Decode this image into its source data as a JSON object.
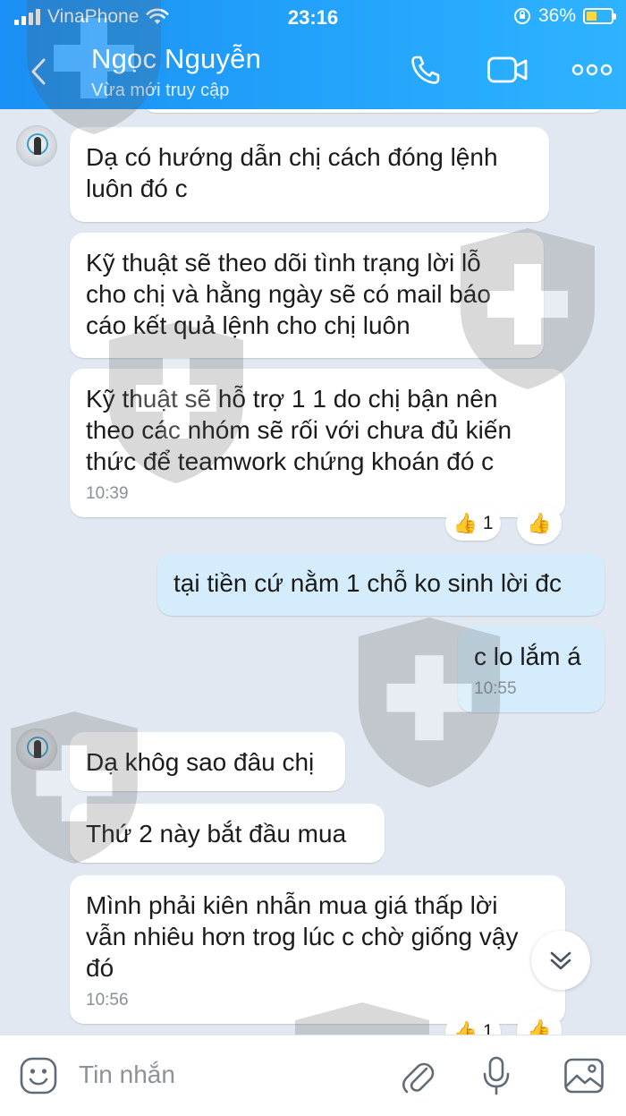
{
  "status_bar": {
    "carrier": "VinaPhone",
    "time": "23:16",
    "battery": "36%",
    "icons": [
      "signal-icon",
      "wifi-icon",
      "orientation-lock-icon",
      "battery-charging-icon"
    ]
  },
  "header": {
    "contact_name": "Ngọc Nguyễn",
    "contact_status": "Vừa mới truy cập",
    "icons": [
      "back-icon",
      "phone-call-icon",
      "video-call-icon",
      "more-icon"
    ]
  },
  "messages": [
    {
      "direction": "in",
      "text_lines": [
        "Dạ có hướng dẫn chị cách đóng lệnh",
        "luôn đó c"
      ]
    },
    {
      "direction": "in",
      "text_lines": [
        "Kỹ thuật sẽ theo dõi tình trạng lời lỗ",
        "cho chị và hằng ngày sẽ có mail báo",
        "cáo kết quả lệnh cho chị luôn"
      ]
    },
    {
      "direction": "in",
      "text_lines": [
        "Kỹ thuật sẽ hỗ trợ 1 1 do chị bận nên",
        "theo các nhóm sẽ rối với chưa đủ kiến",
        "thức để teamwork chứng khoán đó c"
      ],
      "time": "10:39",
      "reaction_count": "1"
    },
    {
      "direction": "out",
      "text_lines": [
        "tại tiền cứ nằm 1 chỗ ko sinh lời đc"
      ]
    },
    {
      "direction": "out",
      "text_lines": [
        "c lo lắm á"
      ],
      "time": "10:55"
    },
    {
      "direction": "in",
      "text_lines": [
        "Dạ khôg sao đâu chị"
      ]
    },
    {
      "direction": "in",
      "text_lines": [
        "Thứ 2 này bắt đầu mua"
      ]
    },
    {
      "direction": "in",
      "text_lines": [
        "Mình phải kiên nhẫn mua giá thấp lời",
        "vẫn nhiêu hơn trog lúc c chờ giống vậy",
        "đó"
      ],
      "time": "10:56",
      "reaction_count": "1"
    }
  ],
  "input_bar": {
    "placeholder": "Tin nhắn",
    "icons": [
      "emoji-icon",
      "attach-icon",
      "microphone-icon",
      "image-icon"
    ]
  },
  "colors": {
    "header_blue": "#1a8ff5",
    "chat_background": "#e2e8f1",
    "incoming_bubble": "#ffffff",
    "outgoing_bubble": "#d4ecfb",
    "reaction_like": "#f2a22a"
  }
}
